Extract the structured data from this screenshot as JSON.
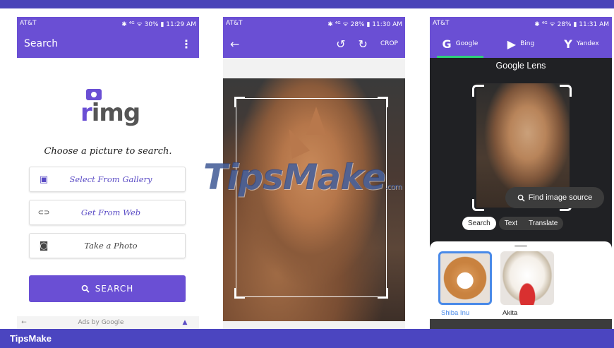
{
  "footer_brand": "TipsMake",
  "watermark": {
    "main": "TipsMake",
    "suffix": ".com"
  },
  "panel1": {
    "status": {
      "carrier": "AT&T",
      "right": "✱ ⁴ᴳ ᯤ 30% ▮ 11:29 AM"
    },
    "title": "Search",
    "menu_icon": "⋮",
    "logo": {
      "text_r": "r",
      "text_rest": "img"
    },
    "prompt": "Choose a picture to search.",
    "options": [
      {
        "label": "Select From Gallery",
        "icon": "gallery-icon",
        "glyph": "▣"
      },
      {
        "label": "Get From Web",
        "icon": "link-icon",
        "glyph": "⊂⊃"
      },
      {
        "label": "Take a Photo",
        "icon": "camera-icon",
        "glyph": "◙"
      }
    ],
    "search_button": "SEARCH",
    "ads_left": "←",
    "ads": "Ads by Google",
    "ads_right": "▲",
    "colors": {
      "accent": "#6a4fd4"
    }
  },
  "panel2": {
    "status": {
      "carrier": "AT&T",
      "right": "✱ ⁴ᴳ ᯤ 28% ▮ 11:30 AM"
    },
    "back": "←",
    "rotate_left": "↺",
    "rotate_right": "↻",
    "crop": "CROP"
  },
  "panel3": {
    "status": {
      "carrier": "AT&T",
      "right": "✱ ⁴ᴳ ᯤ 28% ▮ 11:31 AM"
    },
    "engines": [
      {
        "glyph": "G",
        "name": "Google",
        "active": true
      },
      {
        "glyph": "▶",
        "name": "Bing",
        "active": false
      },
      {
        "glyph": "Y",
        "name": "Yandex",
        "active": false
      }
    ],
    "lens_title": "Google Lens",
    "find_source": "Find image source",
    "tabs": {
      "search": "Search",
      "text": "Text",
      "translate": "Translate"
    },
    "results": [
      {
        "name": "Shiba Inu",
        "selected": true
      },
      {
        "name": "Akita",
        "selected": false
      }
    ]
  }
}
